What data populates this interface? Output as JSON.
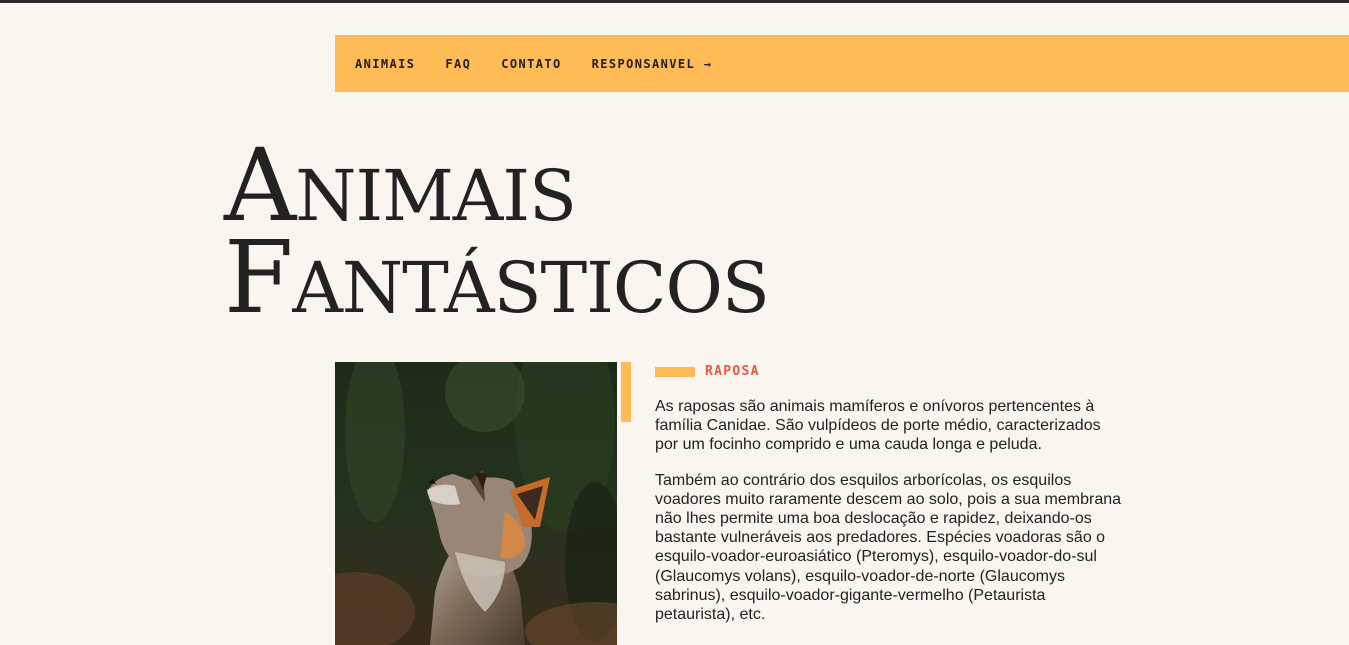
{
  "nav": {
    "items": [
      {
        "label": "ANIMAIS"
      },
      {
        "label": "FAQ"
      },
      {
        "label": "CONTATO"
      },
      {
        "label": "RESPONSANVEL →"
      }
    ]
  },
  "hero": {
    "line1": "Animais",
    "line2": "Fantásticos"
  },
  "animal": {
    "title": "RAPOSA",
    "paragraphs": [
      "As raposas são animais mamíferos e onívoros pertencentes à família Canidae. São vulpídeos de porte médio, caracterizados por um focinho comprido e uma cauda longa e peluda.",
      "Também ao contrário dos esquilos arborícolas, os esquilos voadores muito raramente descem ao solo, pois a sua membrana não lhes permite uma boa deslocação e rapidez, deixando-os bastante vulneráveis aos predadores. Espécies voadoras são o esquilo-voador-euroasiático (Pteromys), esquilo-voador-do-sul (Glaucomys volans), esquilo-voador-de-norte (Glaucomys sabrinus), esquilo-voador-gigante-vermelho (Petaurista petaurista), etc."
    ]
  },
  "colors": {
    "background": "#FAF6EF",
    "accent": "#FFBB55",
    "title_red": "#E55A3C",
    "text": "#222222"
  }
}
